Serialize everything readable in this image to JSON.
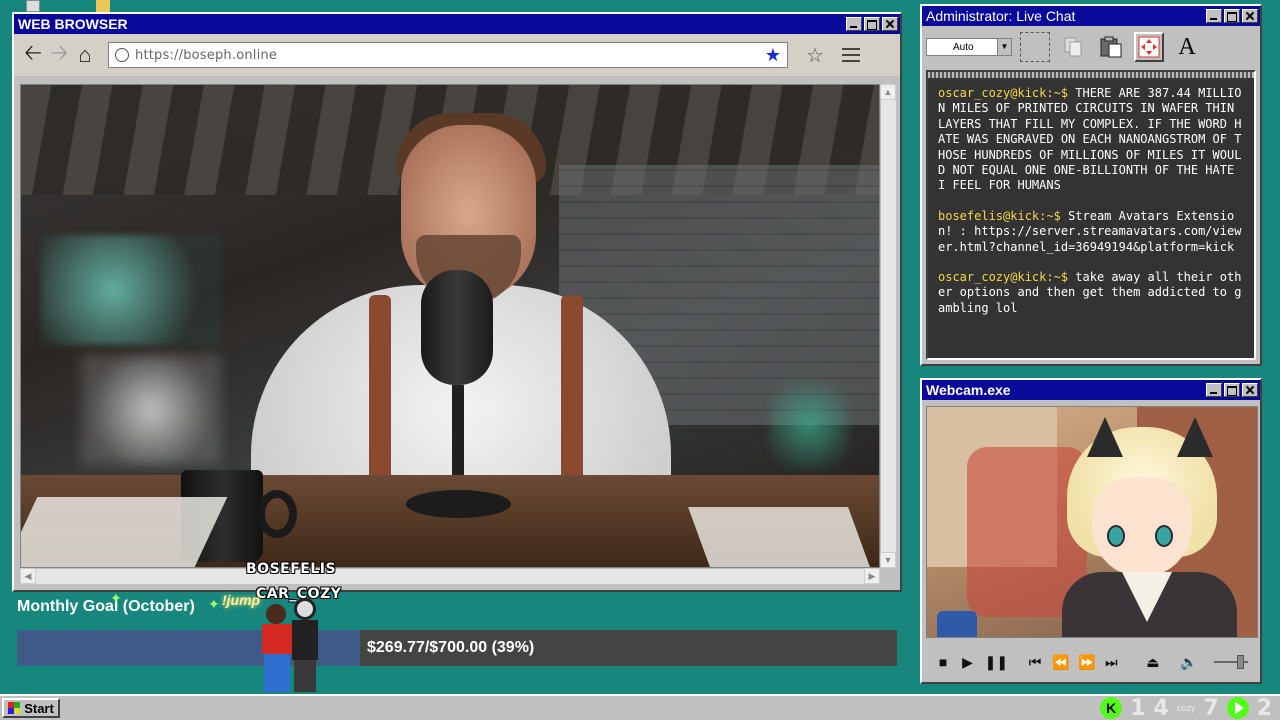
{
  "browser": {
    "title": "WEB BROWSER",
    "url": "https://boseph.online",
    "icons": {
      "back": "back-arrow-icon",
      "forward": "forward-arrow-icon",
      "home": "home-icon",
      "bookmark": "bookmark-star-icon",
      "favorite": "star-outline-icon",
      "menu": "hamburger-menu-icon"
    }
  },
  "chat": {
    "title": "Administrator: Live Chat",
    "dropdown_value": "Auto",
    "messages": [
      {
        "user": "oscar_cozy@kick:~$",
        "text": "THERE ARE 387.44 MILLION MILES OF PRINTED CIRCUITS IN WAFER THIN LAYERS THAT FILL MY COMPLEX. IF THE WORD HATE WAS ENGRAVED ON EACH NANOANGSTROM OF THOSE HUNDREDS OF MILLIONS OF MILES IT WOULD NOT EQUAL ONE ONE-BILLIONTH OF THE HATE I FEEL FOR HUMANS"
      },
      {
        "user": "bosefelis@kick:~$",
        "text": "Stream Avatars Extension! : https://server.streamavatars.com/viewer.html?channel_id=36949194&platform=kick"
      },
      {
        "user": "oscar_cozy@kick:~$",
        "text": "take away all their other options and then get them addicted to gambling lol"
      }
    ],
    "user_color": "#f6d64a"
  },
  "webcam": {
    "title": "Webcam.exe"
  },
  "goal": {
    "label": "Monthly Goal (October)",
    "text": "$269.77/$700.00 (39%)",
    "progress": 0.39,
    "fill_color": "#3d5b86"
  },
  "avatars": {
    "name1": "BOSEFELIS",
    "name2": "CAR_COZY",
    "action": "!jump"
  },
  "taskbar": {
    "start_label": "Start",
    "tray_count1": "1",
    "tray_count2": "4",
    "tray_brand": "cozy",
    "tray_count3": "7",
    "tray_count4": "2"
  },
  "colors": {
    "desktop": "#17877e",
    "titlebar": "#0a0a9a",
    "kick_green": "#53fc18"
  }
}
